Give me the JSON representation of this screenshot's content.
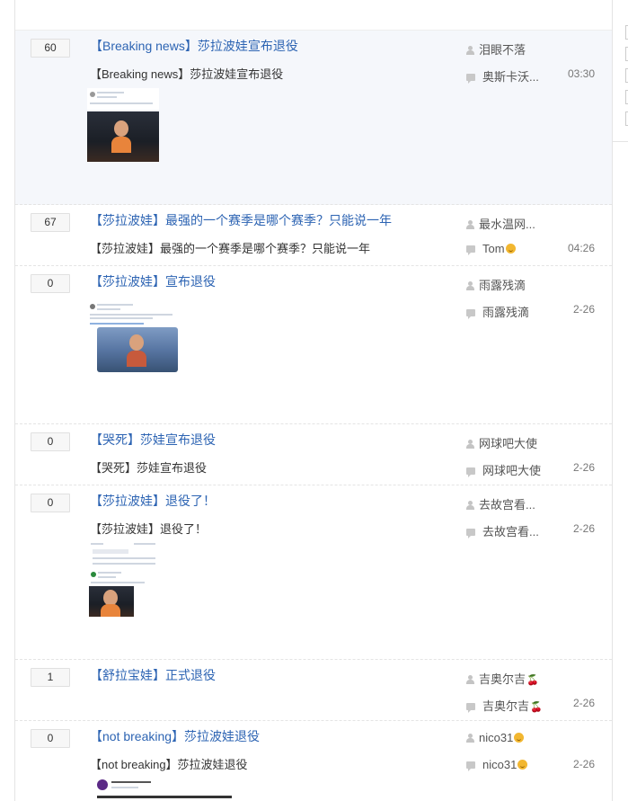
{
  "threads": [
    {
      "replies": "60",
      "title": "【Breaking news】莎拉波娃宣布退役",
      "abstract": "【Breaking news】莎拉波娃宣布退役",
      "author": "泪眼不落",
      "last_reply_user": "奥斯卡沃...",
      "time": "03:30",
      "highlighted": true,
      "has_image": true
    },
    {
      "replies": "67",
      "title": "【莎拉波娃】最强的一个赛季是哪个赛季？只能说一年",
      "abstract": "【莎拉波娃】最强的一个赛季是哪个赛季？只能说一年",
      "author": "最水温网...",
      "last_reply_user": "Tom",
      "last_reply_emoji": "grin-emoji",
      "time": "04:26",
      "has_image": false
    },
    {
      "replies": "0",
      "title": "【莎拉波娃】宣布退役",
      "abstract": "",
      "author": "雨露残滴",
      "last_reply_user": "雨露残滴",
      "time": "2-26",
      "has_image": true
    },
    {
      "replies": "0",
      "title": "【哭死】莎娃宣布退役",
      "abstract": "【哭死】莎娃宣布退役",
      "author": "网球吧大使",
      "last_reply_user": "网球吧大使",
      "time": "2-26",
      "has_image": false
    },
    {
      "replies": "0",
      "title": "【莎拉波娃】退役了！",
      "abstract": "【莎拉波娃】退役了！",
      "author": "去故宫看...",
      "last_reply_user": "去故宫看...",
      "time": "2-26",
      "has_image": true
    },
    {
      "replies": "1",
      "title": "【舒拉宝娃】正式退役",
      "abstract": "",
      "author": "吉奥尔吉",
      "author_emoji": "cherry-emoji",
      "last_reply_user": "吉奥尔吉",
      "last_reply_emoji": "cherry-emoji",
      "time": "2-26",
      "has_image": false
    },
    {
      "replies": "0",
      "title": "【not breaking】莎拉波娃退役",
      "abstract": "【not breaking】莎拉波娃退役",
      "author": "nico31",
      "author_emoji": "grin-emoji",
      "last_reply_user": "nico31",
      "last_reply_emoji": "grin-emoji",
      "time": "2-26",
      "has_image": true
    }
  ],
  "colors": {
    "title_link": "#2d64b3",
    "highlight_bg": "#f5f7fb",
    "border": "#e4e4e4"
  }
}
